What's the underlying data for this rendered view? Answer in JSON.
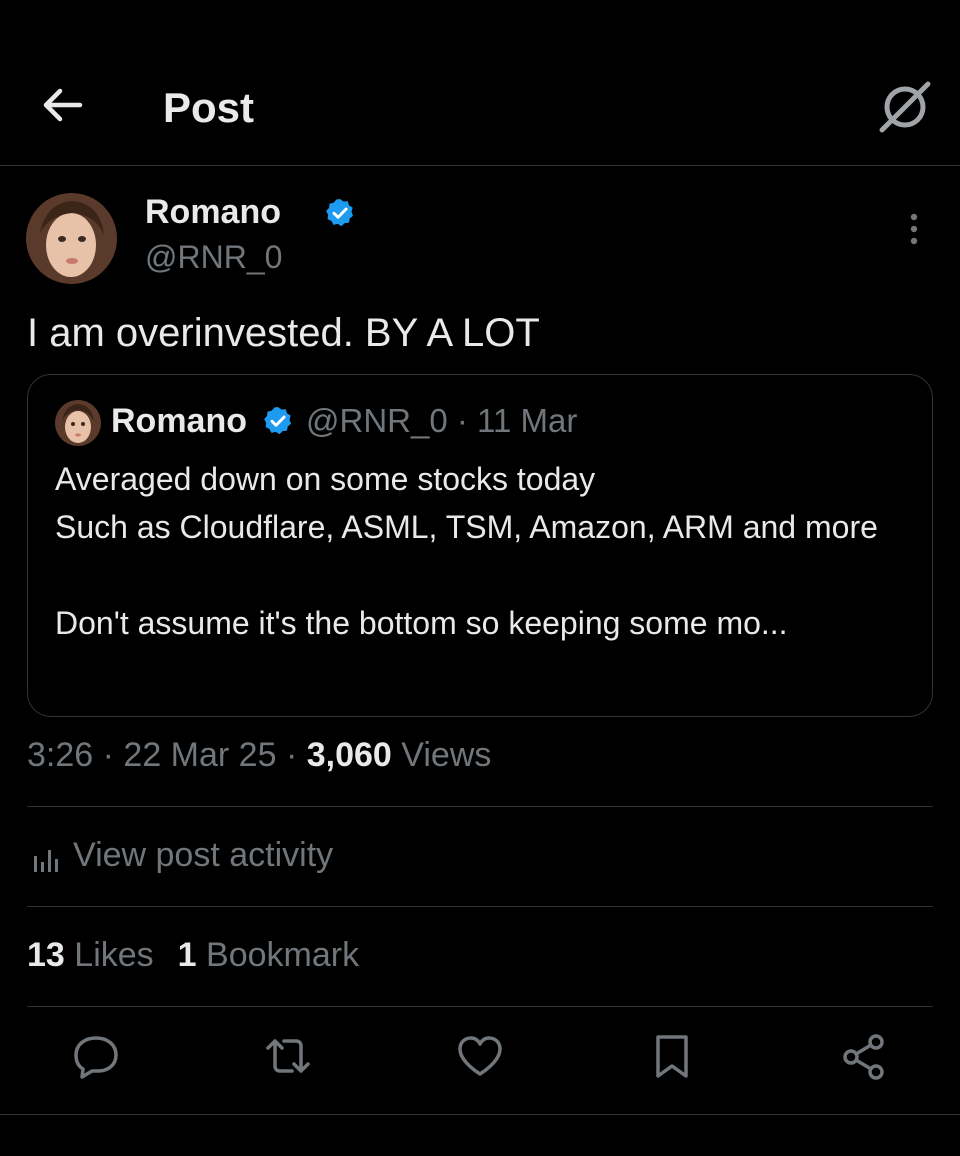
{
  "header": {
    "title": "Post"
  },
  "post": {
    "author_name": "Romano",
    "author_handle": "@RNR_0",
    "text": "I am overinvested. BY A LOT",
    "quote": {
      "author_name": "Romano",
      "author_handle": "@RNR_0",
      "date": "11 Mar",
      "lines": [
        "Averaged down on some stocks today",
        "Such as Cloudflare, ASML, TSM, Amazon, ARM and more",
        "",
        "Don't assume it's the bottom so keeping some mo..."
      ]
    },
    "time": "3:26",
    "date": "22 Mar 25",
    "views_count": "3,060",
    "views_label": "Views",
    "activity_label": "View post activity",
    "likes_count": "13",
    "likes_label": "Likes",
    "bookmarks_count": "1",
    "bookmarks_label": "Bookmark"
  },
  "colors": {
    "background": "#000000",
    "text": "#e7e9ea",
    "muted": "#71767b",
    "verified": "#1d9bf0",
    "divider": "#2f3336"
  },
  "icons": {
    "back": "back-arrow-icon",
    "grok": "grok-icon",
    "more": "more-vertical-icon",
    "verified": "verified-badge-icon",
    "activity": "bar-chart-icon",
    "reply": "reply-icon",
    "repost": "repost-icon",
    "like": "heart-icon",
    "bookmark": "bookmark-icon",
    "share": "share-icon"
  }
}
